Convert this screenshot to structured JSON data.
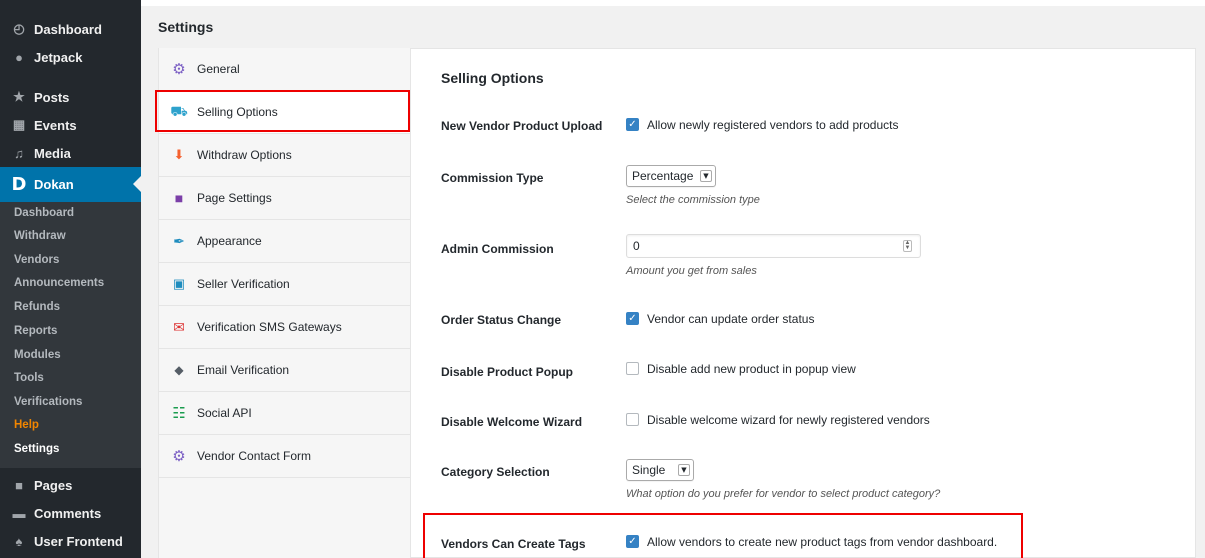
{
  "sidebar": {
    "menu": [
      {
        "label": "Dashboard",
        "icon": "dashboard-icon",
        "glyph": "◴"
      },
      {
        "label": "Jetpack",
        "icon": "jetpack-icon",
        "glyph": "●"
      },
      {
        "label": "Posts",
        "icon": "pin-icon",
        "glyph": "★"
      },
      {
        "label": "Events",
        "icon": "calendar-icon",
        "glyph": "▦"
      },
      {
        "label": "Media",
        "icon": "media-icon",
        "glyph": "♫"
      },
      {
        "label": "Dokan",
        "icon": "dokan-icon",
        "glyph": "D"
      }
    ],
    "submenu": [
      "Dashboard",
      "Withdraw",
      "Vendors",
      "Announcements",
      "Refunds",
      "Reports",
      "Modules",
      "Tools",
      "Verifications",
      "Help",
      "Settings"
    ],
    "bottom": [
      {
        "label": "Pages",
        "icon": "pages-icon",
        "glyph": "■"
      },
      {
        "label": "Comments",
        "icon": "comments-icon",
        "glyph": "▬"
      },
      {
        "label": "User Frontend",
        "icon": "user-frontend-icon",
        "glyph": "♠"
      }
    ]
  },
  "page": {
    "title": "Settings"
  },
  "nav": [
    {
      "label": "General",
      "icon": "gear-icon",
      "glyph": "⚙",
      "color": "#7b5fc4"
    },
    {
      "label": "Selling Options",
      "icon": "cart-icon",
      "glyph": "⛟",
      "color": "#2ea2cc"
    },
    {
      "label": "Withdraw Options",
      "icon": "withdraw-icon",
      "glyph": "⬇",
      "color": "#f5612f"
    },
    {
      "label": "Page Settings",
      "icon": "page-icon",
      "glyph": "■",
      "color": "#7b3fa8"
    },
    {
      "label": "Appearance",
      "icon": "brush-icon",
      "glyph": "✒",
      "color": "#1e8cbe"
    },
    {
      "label": "Seller Verification",
      "icon": "lock-icon",
      "glyph": "▣",
      "color": "#1e8cbe"
    },
    {
      "label": "Verification SMS Gateways",
      "icon": "envelope-icon",
      "glyph": "✉",
      "color": "#dd3333"
    },
    {
      "label": "Email Verification",
      "icon": "shield-icon",
      "glyph": "◆",
      "color": "#555d66"
    },
    {
      "label": "Social API",
      "icon": "network-icon",
      "glyph": "☷",
      "color": "#1a9c4e"
    },
    {
      "label": "Vendor Contact Form",
      "icon": "gear-icon",
      "glyph": "⚙",
      "color": "#7b5fc4"
    }
  ],
  "section": {
    "title": "Selling Options"
  },
  "fields": {
    "upload": {
      "label": "New Vendor Product Upload",
      "text": "Allow newly registered vendors to add products",
      "checked": true
    },
    "commission_type": {
      "label": "Commission Type",
      "value": "Percentage",
      "desc": "Select the commission type"
    },
    "admin_commission": {
      "label": "Admin Commission",
      "value": "0",
      "desc": "Amount you get from sales"
    },
    "order_status": {
      "label": "Order Status Change",
      "text": "Vendor can update order status",
      "checked": true
    },
    "popup": {
      "label": "Disable Product Popup",
      "text": "Disable add new product in popup view",
      "checked": false
    },
    "wizard": {
      "label": "Disable Welcome Wizard",
      "text": "Disable welcome wizard for newly registered vendors",
      "checked": false
    },
    "category": {
      "label": "Category Selection",
      "value": "Single",
      "desc": "What option do you prefer for vendor to select product category?"
    },
    "tags": {
      "label": "Vendors Can Create Tags",
      "text": "Allow vendors to create new product tags from vendor dashboard.",
      "checked": true
    }
  },
  "colors": {
    "accent": "#0073aa",
    "highlight": "#ee0000",
    "checkbox": "#3582c4"
  }
}
